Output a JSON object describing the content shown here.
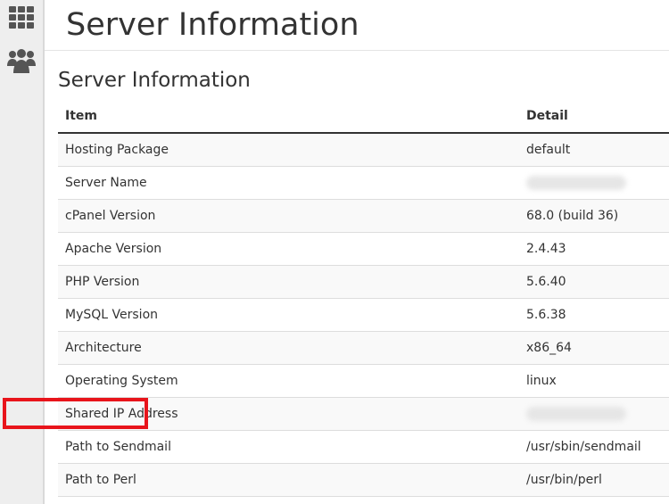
{
  "sidebar": {
    "items": [
      {
        "icon": "apps-grid-icon"
      },
      {
        "icon": "users-group-icon"
      }
    ]
  },
  "header": {
    "title": "Server Information"
  },
  "section": {
    "title": "Server Information"
  },
  "table": {
    "columns": [
      "Item",
      "Detail"
    ],
    "rows": [
      {
        "item": "Hosting Package",
        "detail": "default"
      },
      {
        "item": "Server Name",
        "detail": ""
      },
      {
        "item": "cPanel Version",
        "detail": "68.0 (build 36)"
      },
      {
        "item": "Apache Version",
        "detail": "2.4.43"
      },
      {
        "item": "PHP Version",
        "detail": "5.6.40"
      },
      {
        "item": "MySQL Version",
        "detail": "5.6.38"
      },
      {
        "item": "Architecture",
        "detail": "x86_64"
      },
      {
        "item": "Operating System",
        "detail": "linux"
      },
      {
        "item": "Shared IP Address",
        "detail": ""
      },
      {
        "item": "Path to Sendmail",
        "detail": "/usr/sbin/sendmail"
      },
      {
        "item": "Path to Perl",
        "detail": "/usr/bin/perl"
      }
    ]
  },
  "colors": {
    "sidebar_bg": "#eeeeee",
    "icon": "#555555",
    "highlight": "#e8141b",
    "row_stripe": "#f9f9f9"
  }
}
